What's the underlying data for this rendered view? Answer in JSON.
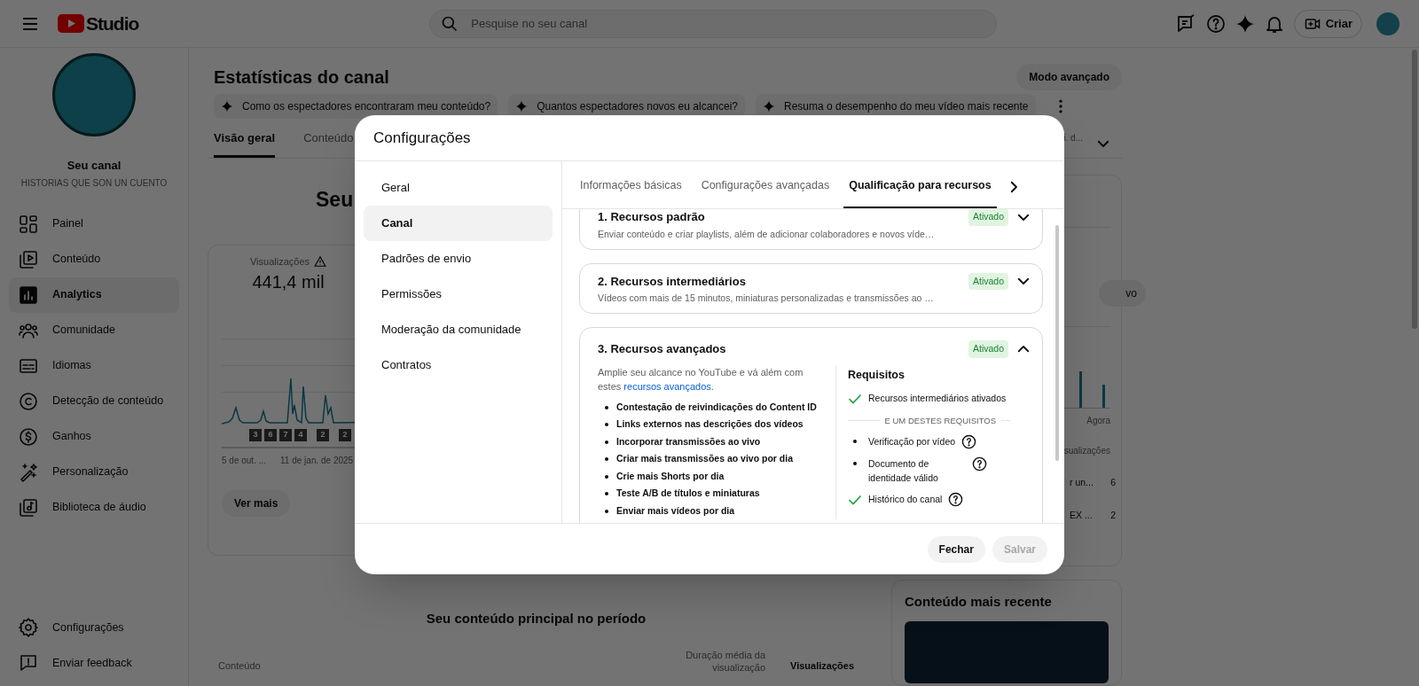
{
  "header": {
    "logo_text": "Studio",
    "search": {
      "placeholder": "Pesquise no seu canal"
    },
    "create_button": "Criar"
  },
  "sidebar": {
    "channel_label": "Seu canal",
    "channel_name": "HISTORIAS QUE SON UN CUENTO",
    "items": [
      {
        "label": "Painel",
        "selected": false
      },
      {
        "label": "Conteúdo",
        "selected": false
      },
      {
        "label": "Analytics",
        "selected": true
      },
      {
        "label": "Comunidade",
        "selected": false
      },
      {
        "label": "Idiomas",
        "selected": false
      },
      {
        "label": "Detecção de conteúdo",
        "selected": false
      },
      {
        "label": "Ganhos",
        "selected": false
      },
      {
        "label": "Personalização",
        "selected": false
      },
      {
        "label": "Biblioteca de áudio",
        "selected": false
      }
    ],
    "bottom_items": [
      {
        "label": "Configurações"
      },
      {
        "label": "Enviar feedback"
      }
    ]
  },
  "page": {
    "title": "Estatísticas do canal",
    "advanced_button": "Modo avançado",
    "suggestions": [
      "Como os espectadores encontraram meu conteúdo?",
      "Quantos espectadores novos eu alcancei?",
      "Resuma o desempenho do meu vídeo mais recente"
    ],
    "tabs": [
      {
        "label": "Visão geral",
        "selected": true
      },
      {
        "label": "Conteúdo",
        "selected": false
      }
    ],
    "period_text": "i. d...",
    "heading": "Seu",
    "views_card": {
      "label": "Visualizações",
      "value": "441,4 mil",
      "markers": [
        "3",
        "6",
        "7",
        "4",
        "2",
        "2"
      ],
      "x_labels": [
        "5 de out. ...",
        "11 de jan. de 2025"
      ],
      "button": "Ver mais"
    },
    "realtime_card": {
      "chip": "vo",
      "x_label": "Agora",
      "column_header": "sualizações",
      "rows": [
        {
          "title": "r un...",
          "value": "6"
        },
        {
          "title": "EX ...",
          "value": "2"
        }
      ]
    },
    "latest_card": {
      "title": "Conteúdo mais recente"
    },
    "top_content": {
      "title": "Seu conteúdo principal no período",
      "columns": [
        "Conteúdo",
        "Duração média da visualização",
        "Visualizações"
      ]
    }
  },
  "dialog": {
    "title": "Configurações",
    "nav": [
      {
        "label": "Geral",
        "selected": false
      },
      {
        "label": "Canal",
        "selected": true
      },
      {
        "label": "Padrões de envio",
        "selected": false
      },
      {
        "label": "Permissões",
        "selected": false
      },
      {
        "label": "Moderação da comunidade",
        "selected": false
      },
      {
        "label": "Contratos",
        "selected": false
      }
    ],
    "tabs": [
      {
        "label": "Informações básicas",
        "selected": false
      },
      {
        "label": "Configurações avançadas",
        "selected": false
      },
      {
        "label": "Qualificação para recursos",
        "selected": true
      }
    ],
    "sections": [
      {
        "title": "1. Recursos padrão",
        "description": "Enviar conteúdo e criar playlists, além de adicionar colaboradores e novos víde…",
        "status": "Ativado",
        "expanded": false
      },
      {
        "title": "2. Recursos intermediários",
        "description": "Vídeos com mais de 15 minutos, miniaturas personalizadas e transmissões ao …",
        "status": "Ativado",
        "expanded": false
      },
      {
        "title": "3. Recursos avançados",
        "status": "Ativado",
        "expanded": true,
        "intro": "Amplie seu alcance no YouTube e vá além com estes",
        "intro_link": "recursos avançados",
        "intro_end": ".",
        "features": [
          "Contestação de reivindicações do Content ID",
          "Links externos nas descrições dos vídeos",
          "Incorporar transmissões ao vivo",
          "Criar mais transmissões ao vivo por dia",
          "Crie mais Shorts por dia",
          "Teste A/B de títulos e miniaturas",
          "Enviar mais vídeos por dia"
        ],
        "requirements_title": "Requisitos",
        "requirements": [
          {
            "text": "Recursos intermediários ativados",
            "kind": "met",
            "help": false
          }
        ],
        "alternatives_label": "E UM DESTES REQUISITOS",
        "alternatives": [
          {
            "text": "Verificação por vídeo",
            "kind": "option",
            "help": true
          },
          {
            "text": "Documento de identidade válido",
            "kind": "option",
            "help": true
          },
          {
            "text": "Histórico do canal",
            "kind": "met",
            "help": true
          }
        ]
      }
    ],
    "buttons": [
      {
        "label": "Fechar",
        "disabled": false
      },
      {
        "label": "Salvar",
        "disabled": true
      }
    ]
  }
}
